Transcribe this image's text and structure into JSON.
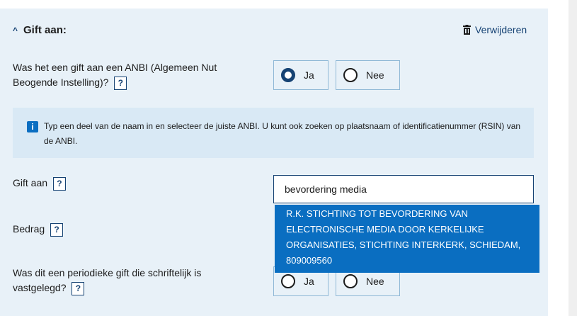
{
  "section": {
    "title": "Gift aan:",
    "delete_label": "Verwijderen"
  },
  "questions": {
    "anbi": {
      "text": "Was het een gift aan een ANBI (Algemeen Nut Beogende Instelling)?",
      "help": "?",
      "options": {
        "yes": "Ja",
        "no": "Nee"
      },
      "selected": "Ja"
    },
    "gift_to": {
      "label": "Gift aan",
      "help": "?"
    },
    "amount": {
      "label": "Bedrag",
      "help": "?"
    },
    "periodic": {
      "text": "Was dit een periodieke gift die schriftelijk is vastgelegd?",
      "help": "?",
      "options": {
        "yes": "Ja",
        "no": "Nee"
      }
    }
  },
  "info": {
    "text": "Typ een deel van de naam in en selecteer de juiste ANBI. U kunt ook zoeken op plaatsnaam of identificatienummer (RSIN) van de ANBI."
  },
  "search": {
    "value": "bevordering media",
    "suggestion": "R.K. STICHTING TOT BEVORDERING VAN ELECTRONISCHE MEDIA DOOR KERKELIJKE ORGANISATIES, STICHTING INTERKERK, SCHIEDAM, 809009560"
  }
}
